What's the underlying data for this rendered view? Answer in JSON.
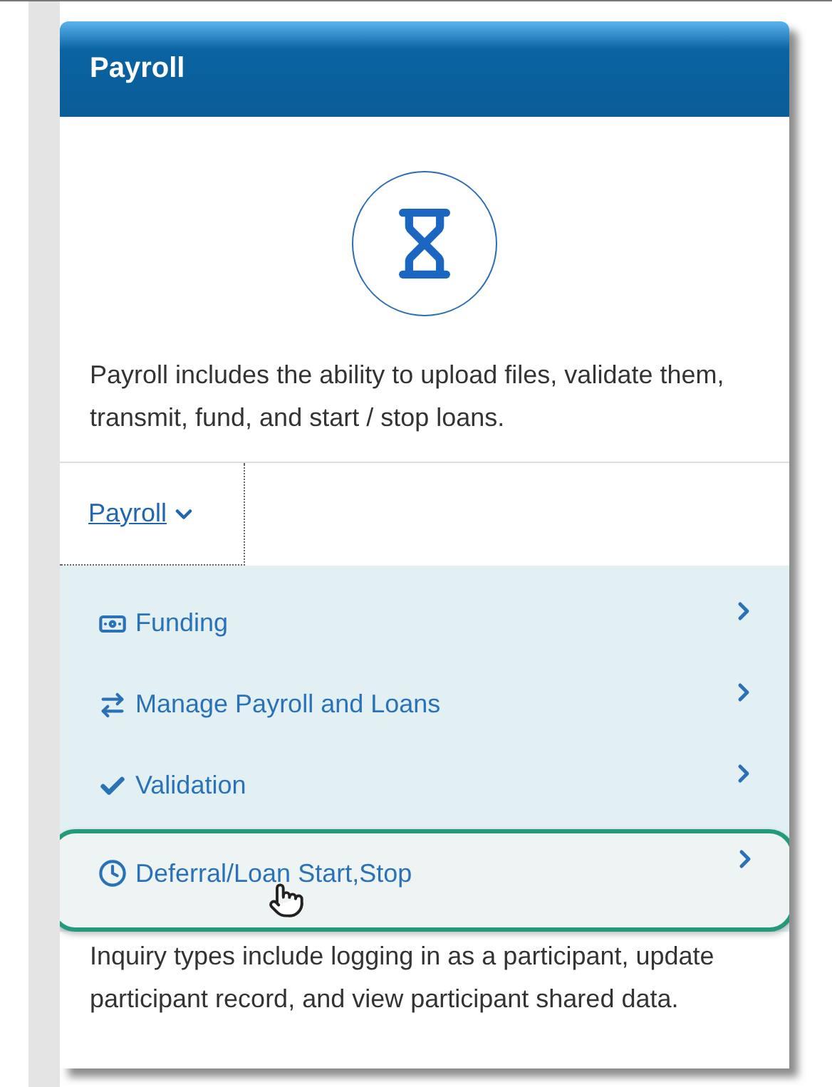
{
  "panel": {
    "title": "Payroll",
    "description": "Payroll includes the ability to upload files, validate them, transmit, fund, and start / stop loans."
  },
  "dropdown": {
    "label": "Payroll",
    "expanded": true
  },
  "menu": [
    {
      "label": "Funding",
      "selected": false
    },
    {
      "label": "Manage Payroll and Loans",
      "selected": false
    },
    {
      "label": "Validation",
      "selected": false
    },
    {
      "label": "Deferral/Loan Start,Stop",
      "selected": true
    }
  ],
  "footer_text": "Inquiry types include logging in as a participant, update participant record, and view participant shared data."
}
